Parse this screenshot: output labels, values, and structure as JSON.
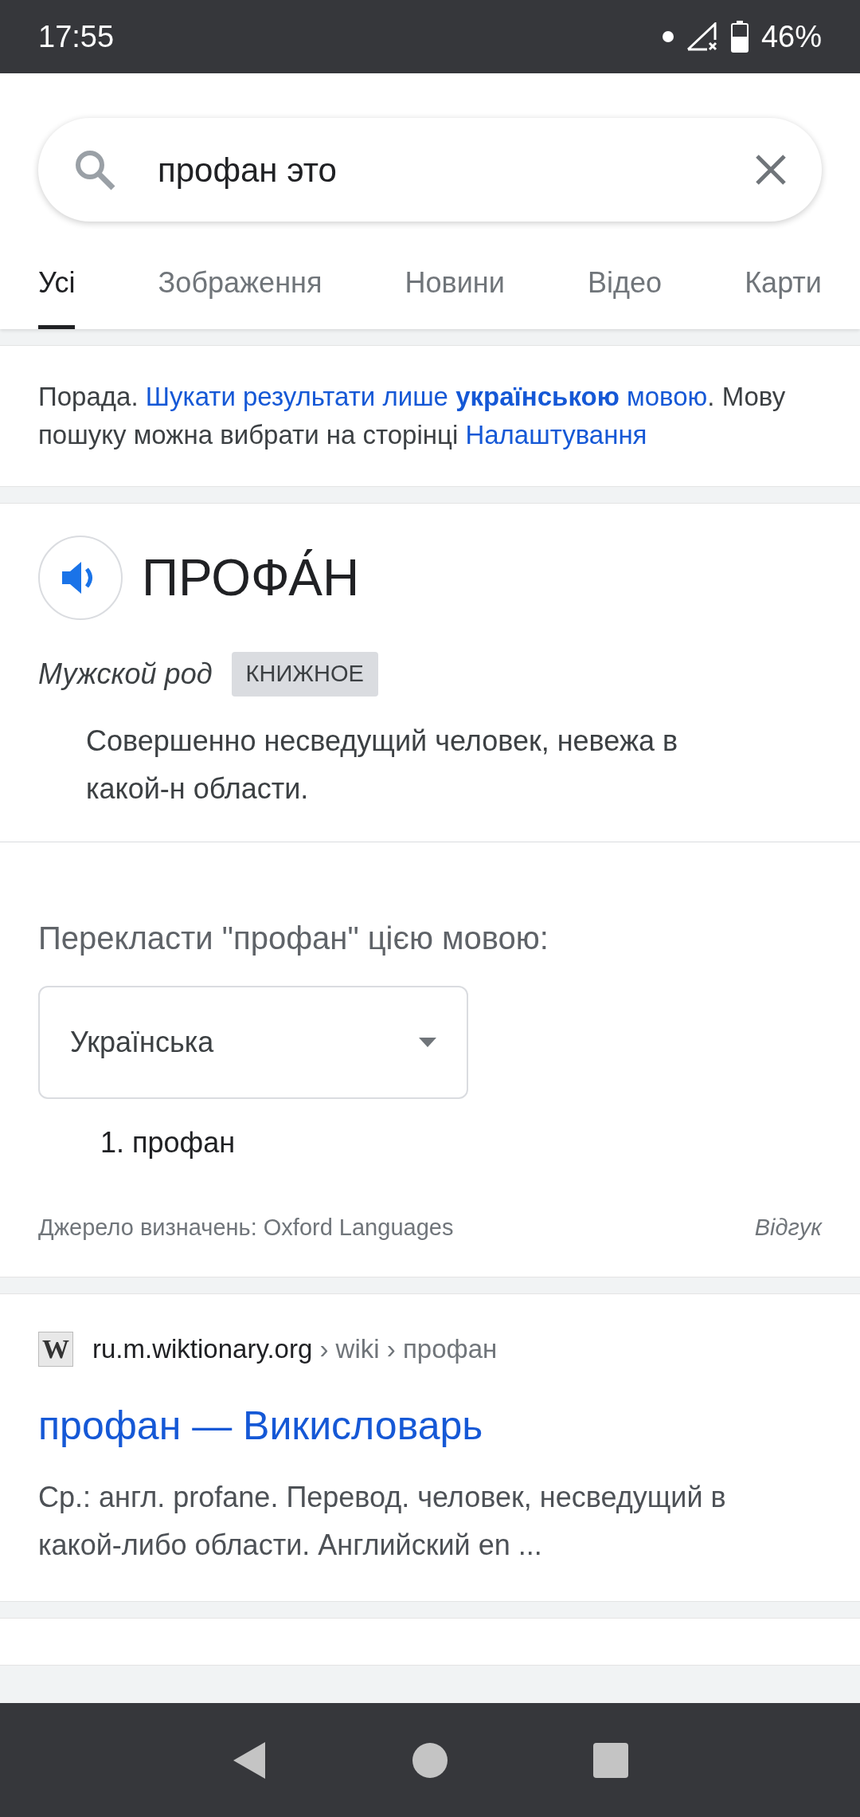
{
  "status_bar": {
    "time": "17:55",
    "battery": "46%"
  },
  "search": {
    "value": "профан это"
  },
  "tabs": [
    {
      "label": "Усі",
      "selected": true
    },
    {
      "label": "Зображення",
      "selected": false
    },
    {
      "label": "Новини",
      "selected": false
    },
    {
      "label": "Відео",
      "selected": false
    },
    {
      "label": "Карти",
      "selected": false
    }
  ],
  "tip": [
    {
      "kind": "text",
      "text": "Порада. "
    },
    {
      "kind": "link",
      "text": "Шукати результати лише **українською** мовою"
    },
    {
      "kind": "text",
      "text": ". Мову пошуку можна вибрати на сторінці "
    },
    {
      "kind": "link",
      "text": "Налаштування"
    }
  ],
  "dictionary": {
    "word": "ПРОФА́Н",
    "gender": "Мужской род",
    "tag": "КНИЖНОЕ",
    "definition": "Совершенно несведущий человек, невежа в какой-н области.",
    "translate_label": "Перекласти \"профан\" цією мовою:",
    "language": "Українська",
    "translations": [
      "1. профан"
    ],
    "source": "Джерело визначень: Oxford Languages",
    "feedback": "Відгук"
  },
  "results": [
    {
      "favicon": "W",
      "site": "ru.m.wiktionary.org",
      "path": " › wiki › профан",
      "title": "профан — Викисловарь",
      "snippet": "Ср.: англ. profane. Перевод. человек, несведущий в какой-либо области. Английский en ..."
    }
  ]
}
